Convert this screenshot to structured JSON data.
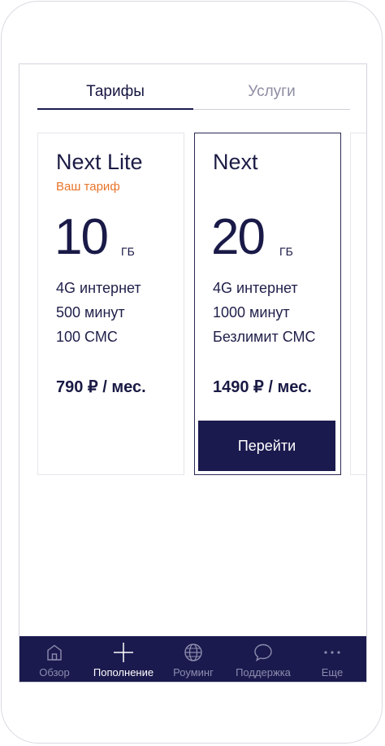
{
  "tabs": [
    {
      "label": "Тарифы",
      "active": true
    },
    {
      "label": "Услуги",
      "active": false
    }
  ],
  "cards": [
    {
      "name": "Next Lite",
      "badge": "Ваш тариф",
      "gb": "10",
      "unit": "ГБ",
      "features": [
        "4G интернет",
        "500 минут",
        "100 СМС"
      ],
      "price": "790 ₽ / мес."
    },
    {
      "name": "Next",
      "gb": "20",
      "unit": "ГБ",
      "features": [
        "4G интернет",
        "1000 минут",
        "Безлимит СМС"
      ],
      "price": "1490 ₽ / мес.",
      "button": "Перейти"
    }
  ],
  "nav": [
    {
      "label": "Обзор",
      "icon": "home-icon"
    },
    {
      "label": "Пополнение",
      "icon": "plus-icon",
      "active": true
    },
    {
      "label": "Роуминг",
      "icon": "globe-icon"
    },
    {
      "label": "Поддержка",
      "icon": "chat-icon"
    },
    {
      "label": "Еще",
      "icon": "more-icon"
    }
  ],
  "colors": {
    "accent": "#1b1a4e",
    "badge": "#e8742b"
  }
}
